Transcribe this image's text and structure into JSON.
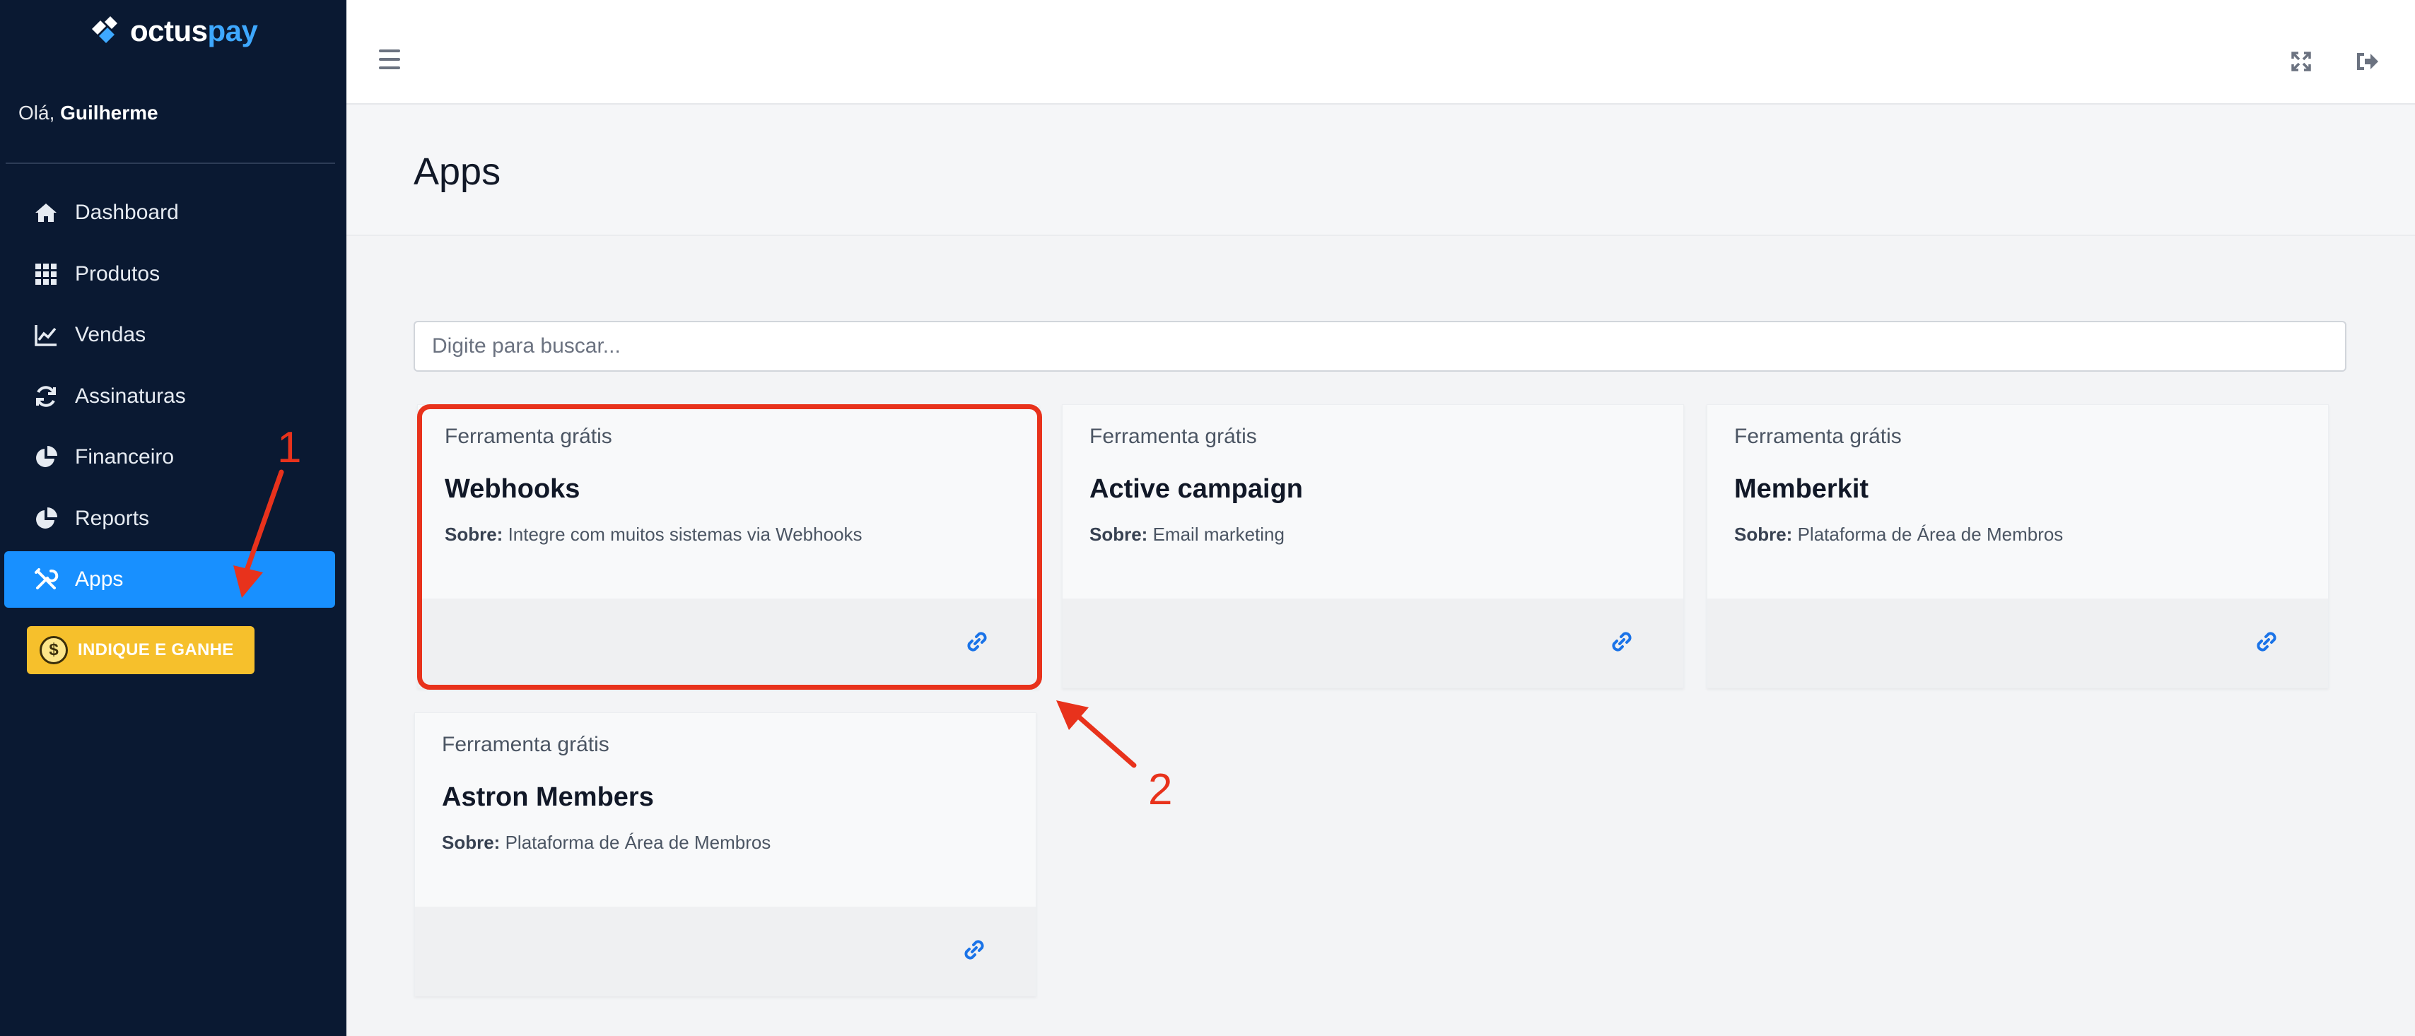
{
  "brand": {
    "part1": "octus",
    "part2": "pay"
  },
  "greeting": {
    "prefix": "Olá, ",
    "name": "Guilherme"
  },
  "sidebar": {
    "items": [
      {
        "label": "Dashboard",
        "icon": "home-icon"
      },
      {
        "label": "Produtos",
        "icon": "grid-icon"
      },
      {
        "label": "Vendas",
        "icon": "line-chart-icon"
      },
      {
        "label": "Assinaturas",
        "icon": "sync-icon"
      },
      {
        "label": "Financeiro",
        "icon": "pie-chart-icon"
      },
      {
        "label": "Reports",
        "icon": "pie-chart-icon"
      },
      {
        "label": "Apps",
        "icon": "tools-icon",
        "active": true
      }
    ],
    "promo_label": "INDIQUE E GANHE",
    "promo_icon": "$"
  },
  "page": {
    "title": "Apps"
  },
  "search": {
    "placeholder": "Digite para buscar...",
    "value": ""
  },
  "apps": [
    {
      "tag": "Ferramenta grátis",
      "name": "Webhooks",
      "about_label": "Sobre:",
      "about": "Integre com muitos sistemas via Webhooks"
    },
    {
      "tag": "Ferramenta grátis",
      "name": "Active campaign",
      "about_label": "Sobre:",
      "about": "Email marketing"
    },
    {
      "tag": "Ferramenta grátis",
      "name": "Memberkit",
      "about_label": "Sobre:",
      "about": "Plataforma de Área de Membros"
    },
    {
      "tag": "Ferramenta grátis",
      "name": "Astron Members",
      "about_label": "Sobre:",
      "about": "Plataforma de Área de Membros"
    }
  ],
  "annotations": {
    "first": "1",
    "second": "2"
  },
  "colors": {
    "sidebar_bg": "#0a1932",
    "accent": "#1890ff",
    "link": "#1a73e8",
    "annotation": "#e8321c",
    "promo": "#f6c02c"
  }
}
